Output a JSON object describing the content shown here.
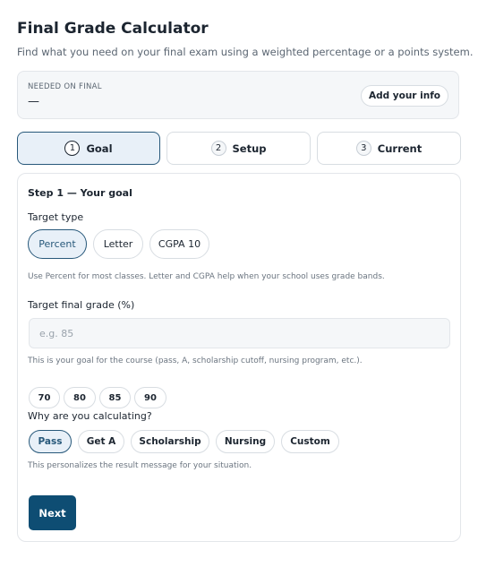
{
  "header": {
    "title": "Final Grade Calculator",
    "subtitle": "Find what you need on your final exam using a weighted percentage or a points system."
  },
  "needed": {
    "label": "NEEDED ON FINAL",
    "value": "—",
    "add_info_label": "Add your info"
  },
  "steps": [
    {
      "num": "1",
      "label": "Goal",
      "active": true
    },
    {
      "num": "2",
      "label": "Setup",
      "active": false
    },
    {
      "num": "3",
      "label": "Current",
      "active": false
    }
  ],
  "goal": {
    "heading": "Step 1 — Your goal",
    "target_type_label": "Target type",
    "target_types": [
      "Percent",
      "Letter",
      "CGPA 10"
    ],
    "selected_target_type": "Percent",
    "target_type_help": "Use Percent for most classes. Letter and CGPA help when your school uses grade bands.",
    "target_grade_label": "Target final grade (%)",
    "target_grade_value": "",
    "target_grade_placeholder": "e.g. 85",
    "target_grade_help": "This is your goal for the course (pass, A, scholarship cutoff, nursing program, etc.).",
    "quick_values": [
      "70",
      "80",
      "85",
      "90"
    ],
    "reason_label": "Why are you calculating?",
    "reasons": [
      "Pass",
      "Get A",
      "Scholarship",
      "Nursing",
      "Custom"
    ],
    "selected_reason": "Pass",
    "reason_help": "This personalizes the result message for your situation.",
    "next_label": "Next"
  }
}
